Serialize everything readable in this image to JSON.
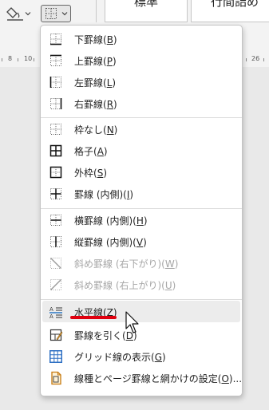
{
  "ribbon": {
    "styles": [
      {
        "label": "標準"
      },
      {
        "label": "行間詰め"
      }
    ]
  },
  "ruler": {
    "labels": [
      "8",
      "10",
      "26"
    ]
  },
  "menu": {
    "items": [
      {
        "key": "bottom",
        "text": "下罫線(",
        "accel": "B",
        "suffix": ")",
        "icon": "border-bottom-icon",
        "enabled": true
      },
      {
        "key": "top",
        "text": "上罫線(",
        "accel": "P",
        "suffix": ")",
        "icon": "border-top-icon",
        "enabled": true
      },
      {
        "key": "left",
        "text": "左罫線(",
        "accel": "L",
        "suffix": ")",
        "icon": "border-left-icon",
        "enabled": true
      },
      {
        "key": "right",
        "text": "右罫線(",
        "accel": "R",
        "suffix": ")",
        "icon": "border-right-icon",
        "enabled": true
      },
      {
        "key": "none",
        "text": "枠なし(",
        "accel": "N",
        "suffix": ")",
        "icon": "no-border-icon",
        "enabled": true
      },
      {
        "key": "all",
        "text": "格子(",
        "accel": "A",
        "suffix": ")",
        "icon": "all-borders-icon",
        "enabled": true
      },
      {
        "key": "outside",
        "text": "外枠(",
        "accel": "S",
        "suffix": ")",
        "icon": "outside-borders-icon",
        "enabled": true
      },
      {
        "key": "inside",
        "text": "罫線 (内側)(",
        "accel": "I",
        "suffix": ")",
        "icon": "inside-borders-icon",
        "enabled": true
      },
      {
        "key": "inner-h",
        "text": "横罫線 (内側)(",
        "accel": "H",
        "suffix": ")",
        "icon": "inside-horizontal-border-icon",
        "enabled": true
      },
      {
        "key": "inner-v",
        "text": "縦罫線 (内側)(",
        "accel": "V",
        "suffix": ")",
        "icon": "inside-vertical-border-icon",
        "enabled": true
      },
      {
        "key": "diag-down",
        "text": "斜め罫線 (右下がり)(",
        "accel": "W",
        "suffix": ")",
        "icon": "diagonal-down-border-icon",
        "enabled": false
      },
      {
        "key": "diag-up",
        "text": "斜め罫線 (右上がり)(",
        "accel": "U",
        "suffix": ")",
        "icon": "diagonal-up-border-icon",
        "enabled": false
      },
      {
        "key": "hline",
        "text": "水平線(",
        "accel": "Z",
        "suffix": ")",
        "icon": "horizontal-line-icon",
        "enabled": true
      },
      {
        "key": "draw",
        "text": "罫線を引く(",
        "accel": "D",
        "suffix": ")",
        "icon": "draw-table-icon",
        "enabled": true
      },
      {
        "key": "grid",
        "text": "グリッド線の表示(",
        "accel": "G",
        "suffix": ")",
        "icon": "view-gridlines-icon",
        "enabled": true
      },
      {
        "key": "settings",
        "text": "線種とページ罫線と網かけの設定(",
        "accel": "O",
        "suffix": ")...",
        "icon": "borders-and-shading-icon",
        "enabled": true
      }
    ]
  },
  "colors": {
    "highlight_underline": "#e0000f",
    "disabled_text": "#a6a6a6",
    "hover_bg": "#ececec"
  }
}
